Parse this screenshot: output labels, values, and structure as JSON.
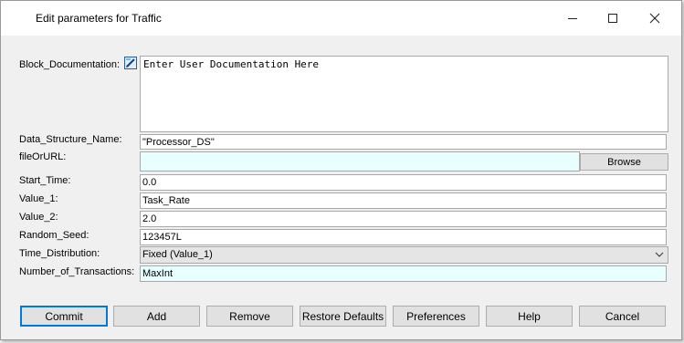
{
  "window": {
    "title": "Edit parameters for Traffic",
    "minimize_icon": "minimize-icon",
    "maximize_icon": "maximize-icon",
    "close_icon": "close-icon"
  },
  "fields": {
    "block_documentation": {
      "label": "Block_Documentation:",
      "value": "Enter User Documentation Here",
      "icon": "edit-doc-icon"
    },
    "data_structure_name": {
      "label": "Data_Structure_Name:",
      "value": "\"Processor_DS\""
    },
    "file_or_url": {
      "label": "fileOrURL:",
      "value": "",
      "browse_label": "Browse"
    },
    "start_time": {
      "label": "Start_Time:",
      "value": "0.0"
    },
    "value_1": {
      "label": "Value_1:",
      "value": "Task_Rate"
    },
    "value_2": {
      "label": "Value_2:",
      "value": "2.0"
    },
    "random_seed": {
      "label": "Random_Seed:",
      "value": "123457L"
    },
    "time_distribution": {
      "label": "Time_Distribution:",
      "value": "Fixed (Value_1)"
    },
    "number_of_transactions": {
      "label": "Number_of_Transactions:",
      "value": "MaxInt"
    }
  },
  "buttons": {
    "commit": "Commit",
    "add": "Add",
    "remove": "Remove",
    "restore_defaults": "Restore Defaults",
    "preferences": "Preferences",
    "help": "Help",
    "cancel": "Cancel"
  },
  "colors": {
    "cyan_field": "#e8ffff",
    "focus_border": "#0078d7"
  }
}
